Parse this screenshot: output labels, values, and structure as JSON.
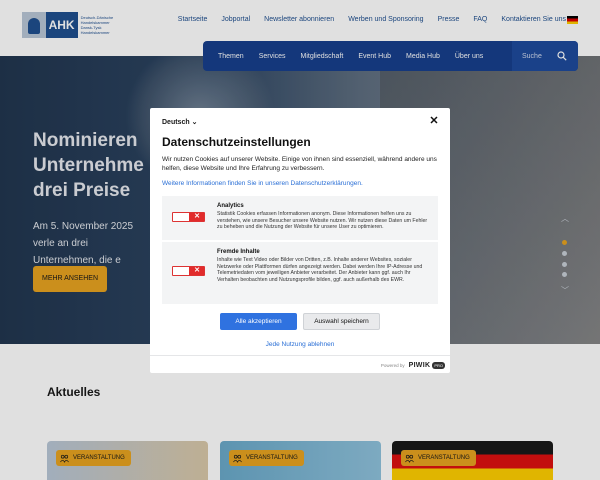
{
  "logo": {
    "mark": "AHK",
    "subtitle": "Deutsch-Dänische Handelskammer Dansk-Tysk Handelskammer"
  },
  "topnav": [
    "Startseite",
    "Jobportal",
    "Newsletter abonnieren",
    "Werben und Sponsoring",
    "Presse",
    "FAQ",
    "Kontaktieren Sie uns"
  ],
  "mainnav": {
    "items": [
      "Themen",
      "Services",
      "Mitgliedschaft",
      "Event Hub",
      "Media Hub",
      "Über uns"
    ],
    "search_label": "Suche"
  },
  "hero": {
    "title": "Nominieren Unternehme drei Preise",
    "text": "Am 5. November 2025 verle an drei Unternehmen, die e",
    "button": "MEHR ANSEHEN"
  },
  "section": {
    "title": "Aktuelles"
  },
  "cards": [
    {
      "badge": "VERANSTALTUNG"
    },
    {
      "badge": "VERANSTALTUNG"
    },
    {
      "badge": "VERANSTALTUNG"
    }
  ],
  "consent": {
    "language": "Deutsch",
    "title": "Datenschutzeinstellungen",
    "intro": "Wir nutzen Cookies auf unserer Website. Einige von ihnen sind essenziell, während andere uns helfen, diese Website und Ihre Erfahrung zu verbessern.",
    "more_link": "Weitere Informationen finden Sie in unseren Datenschutzerklärungen.",
    "options": [
      {
        "title": "Analytics",
        "text": "Statistik Cookies erfassen Informationen anonym. Diese Informationen helfen uns zu verstehen, wie unsere Besucher unsere Website nutzen. Wir nutzen diese Daten um Fehler zu beheben und die Nutzung der Website für unsere User zu optimieren."
      },
      {
        "title": "Fremde Inhalte",
        "text": "Inhalte wie Text Video oder Bilder von Dritten, z.B. Inhalte anderer Websites, sozialer Netzwerke oder Plattformen dürfen angezeigt werden. Dabei werden Ihre IP-Adresse und Telemetriedaten vom jeweiligen Anbieter verarbeitet. Der Anbieter kann ggf. auch Ihr Verhalten beobachten und Nutzungsprofile bilden, ggf. auch außerhalb des EWR."
      }
    ],
    "toggle_symbol": "✕",
    "accept_all": "Alle akzeptieren",
    "save": "Auswahl speichern",
    "reject": "Jede Nutzung ablehnen",
    "powered_by": "Powered by",
    "powered_name": "PIWIK",
    "powered_tag": "PRO",
    "close_symbol": "✕",
    "language_caret": "⌄"
  },
  "colors": {
    "brand_blue": "#173f8c",
    "accent_gold": "#e7a320",
    "toggle_red": "#e12b2b",
    "link_blue": "#2a6fd6"
  }
}
